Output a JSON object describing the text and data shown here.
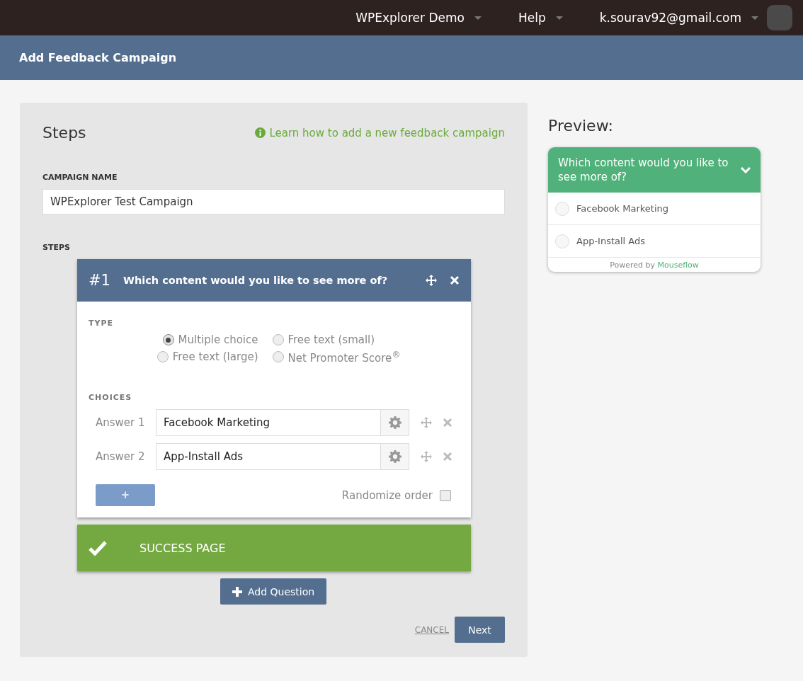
{
  "topbar": {
    "menus": [
      {
        "label": "WPExplorer Demo"
      },
      {
        "label": "Help"
      },
      {
        "label": "k.sourav92@gmail.com"
      }
    ]
  },
  "header": {
    "title": "Add Feedback Campaign"
  },
  "steps_panel": {
    "title": "Steps",
    "help_link": "Learn how to add a new feedback campaign",
    "campaign_name_label": "CAMPAIGN NAME",
    "campaign_name": "WPExplorer Test Campaign",
    "steps_label": "STEPS",
    "question": {
      "number": "#1",
      "title": "Which content would you like to see more of?",
      "type_label": "TYPE",
      "types": [
        {
          "label": "Multiple choice",
          "selected": true
        },
        {
          "label": "Free text (small)",
          "selected": false
        },
        {
          "label": "Free text (large)",
          "selected": false
        },
        {
          "label": "Net Promoter Score$^{®}$",
          "selected": false
        }
      ],
      "choices_label": "CHOICES",
      "answers": [
        {
          "label": "Answer 1",
          "value": "Facebook Marketing"
        },
        {
          "label": "Answer 2",
          "value": "App-Install Ads"
        }
      ],
      "add_answer": "+",
      "randomize": {
        "label": "Randomize order",
        "checked": false
      }
    },
    "success_page": "SUCCESS PAGE",
    "add_question": "Add Question",
    "cancel": "CANCEL",
    "next": "Next"
  },
  "preview": {
    "title": "Preview:",
    "question": "Which content would you like to see more of?",
    "options": [
      {
        "label": "Facebook Marketing",
        "selected": false
      },
      {
        "label": "App-Install Ads",
        "selected": false
      }
    ],
    "powered_by": "Powered by",
    "brand": "Mouseflow"
  }
}
